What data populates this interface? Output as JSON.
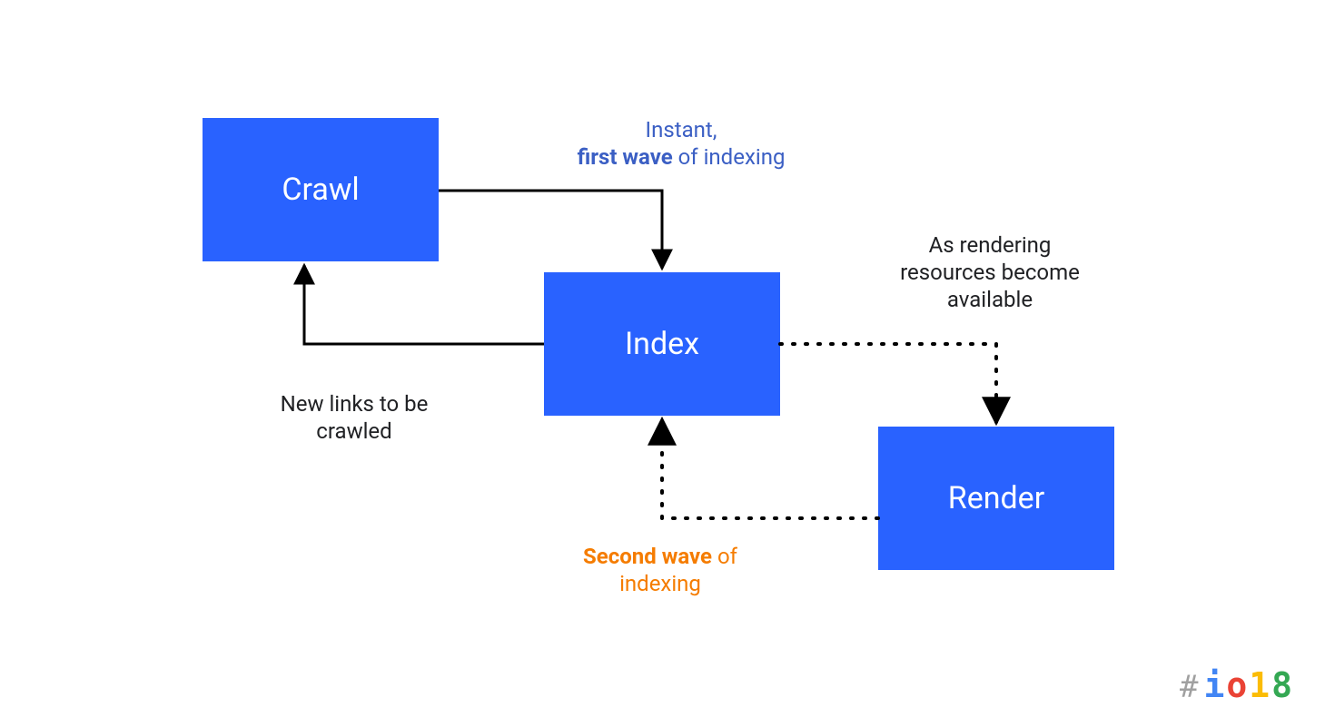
{
  "boxes": {
    "crawl": "Crawl",
    "index": "Index",
    "render": "Render"
  },
  "labels": {
    "first_wave_pre": "Instant,",
    "first_wave_bold": "first wave",
    "first_wave_post": " of indexing",
    "new_links_line1": "New links to be",
    "new_links_line2": "crawled",
    "avail_line1": "As rendering",
    "avail_line2": "resources become",
    "avail_line3": "available",
    "second_wave_bold": "Second wave",
    "second_wave_post": " of",
    "second_wave_line2": "indexing"
  },
  "logo": {
    "hash": "#",
    "c1": "i",
    "c2": "o",
    "c3": "1",
    "c4": "8"
  }
}
